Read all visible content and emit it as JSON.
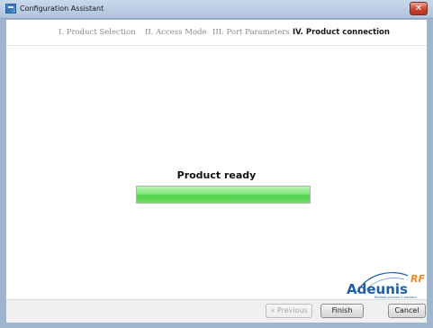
{
  "window": {
    "title": "Configuration Assistant",
    "close_glyph": "✕"
  },
  "steps": [
    {
      "label": "I. Product Selection",
      "active": false
    },
    {
      "label": "II. Access Mode",
      "active": false
    },
    {
      "label": "III. Port Parameters",
      "active": false
    },
    {
      "label": "IV. Product connection",
      "active": true
    }
  ],
  "main": {
    "status": "Product ready",
    "progress_fraction": 1.0
  },
  "logo": {
    "brand": "Adeunis",
    "suffix": "RF",
    "tagline": "Wireless products & solutions",
    "colors": {
      "blue": "#1f5fa8",
      "orange": "#f08a1c"
    }
  },
  "buttons": {
    "previous": "« Previous",
    "finish": "Finish",
    "cancel": "Cancel"
  }
}
